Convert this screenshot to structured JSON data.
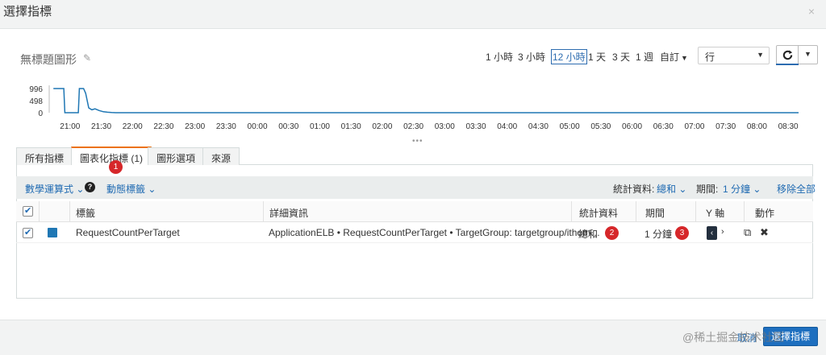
{
  "dialog": {
    "title": "選擇指標",
    "close_glyph": "×"
  },
  "graph": {
    "title": "無標題圖形",
    "edit_glyph": "✎"
  },
  "time_ranges": [
    "1 小時",
    "3 小時",
    "12 小時",
    "1 天",
    "3 天",
    "1 週",
    "自訂"
  ],
  "time_range_active": "12 小時",
  "view_select": {
    "value": "行"
  },
  "chart_data": {
    "type": "line",
    "title": "",
    "ylabel": "",
    "yticks": [
      996,
      498,
      0
    ],
    "ylim": [
      0,
      996
    ],
    "x_ticks": [
      "21:00",
      "21:30",
      "22:00",
      "22:30",
      "23:00",
      "23:30",
      "00:00",
      "00:30",
      "01:00",
      "01:30",
      "02:00",
      "02:30",
      "03:00",
      "03:30",
      "04:00",
      "04:30",
      "05:00",
      "05:30",
      "06:00",
      "06:30",
      "07:00",
      "07:30",
      "08:00",
      "08:30"
    ],
    "series": [
      {
        "color": "#1f77b4",
        "points": [
          [
            "20:44",
            996
          ],
          [
            "20:54",
            996
          ],
          [
            "20:55",
            0
          ],
          [
            "21:08",
            0
          ],
          [
            "21:09",
            996
          ],
          [
            "21:13",
            996
          ],
          [
            "21:15",
            800
          ],
          [
            "21:18",
            200
          ],
          [
            "21:21",
            120
          ],
          [
            "21:24",
            160
          ],
          [
            "21:28",
            90
          ],
          [
            "21:32",
            40
          ],
          [
            "21:36",
            20
          ],
          [
            "21:40",
            5
          ],
          [
            "21:44",
            0
          ],
          [
            "08:40",
            0
          ]
        ]
      }
    ],
    "grid": false,
    "legend": "none"
  },
  "tabs": [
    {
      "label": "所有指標"
    },
    {
      "label": "圖表化指標 (1)"
    },
    {
      "label": "圖形選項"
    },
    {
      "label": "來源"
    }
  ],
  "active_tab": 1,
  "badges": [
    "1",
    "2",
    "3"
  ],
  "toolbar": {
    "math_expression": "數學運算式",
    "dynamic_labels": "動態標籤",
    "statistic_label": "統計資料:",
    "statistic_value": "總和",
    "period_label": "期間:",
    "period_value": "1 分鐘",
    "remove_all": "移除全部"
  },
  "table": {
    "columns": [
      "標籤",
      "詳細資訊",
      "統計資料",
      "期間",
      "Y 軸",
      "動作"
    ],
    "rows": [
      {
        "checked": true,
        "color": "#1f77b4",
        "label": "RequestCountPerTarget",
        "details": "ApplicationELB • RequestCountPerTarget • TargetGroup: targetgroup/ithom…",
        "statistic": "總和",
        "period": "1 分鐘"
      }
    ]
  },
  "footer": {
    "cancel": "取消",
    "select_metrics": "選擇指標",
    "watermark": "@稀土掘金技术社区"
  }
}
